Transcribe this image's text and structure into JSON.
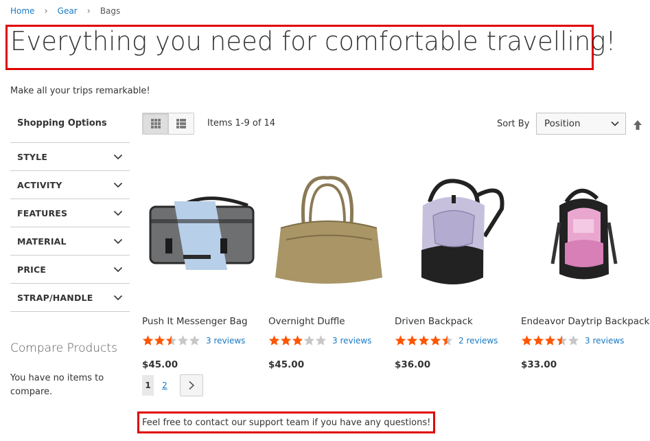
{
  "breadcrumbs": {
    "home": "Home",
    "gear": "Gear",
    "current": "Bags"
  },
  "page": {
    "title": "Everything you need for comfortable travelling!",
    "subtitle": "Make all your trips remarkable!",
    "contact_note": "Feel free to contact our support team if you have any questions!"
  },
  "sidebar": {
    "title": "Shopping Options",
    "filters": [
      {
        "label": "STYLE"
      },
      {
        "label": "ACTIVITY"
      },
      {
        "label": "FEATURES"
      },
      {
        "label": "MATERIAL"
      },
      {
        "label": "PRICE"
      },
      {
        "label": "STRAP/HANDLE"
      }
    ],
    "compare_title": "Compare Products",
    "compare_text": "You have no items to compare."
  },
  "toolbar": {
    "items_count": "Items 1-9 of 14",
    "sort_label": "Sort By",
    "sort_value": "Position"
  },
  "products": [
    {
      "name": "Push It Messenger Bag",
      "rating_stars": 2.5,
      "reviews": "3 reviews",
      "price": "$45.00"
    },
    {
      "name": "Overnight Duffle",
      "rating_stars": 3,
      "reviews": "3 reviews",
      "price": "$45.00"
    },
    {
      "name": "Driven Backpack",
      "rating_stars": 4.5,
      "reviews": "2 reviews",
      "price": "$36.00"
    },
    {
      "name": "Endeavor Daytrip Backpack",
      "rating_stars": 3.5,
      "reviews": "3 reviews",
      "price": "$33.00"
    }
  ],
  "pager": {
    "current": "1",
    "next_page": "2"
  },
  "colors": {
    "link": "#1979c3",
    "star": "#ff5501",
    "highlight_border": "#e00000"
  }
}
